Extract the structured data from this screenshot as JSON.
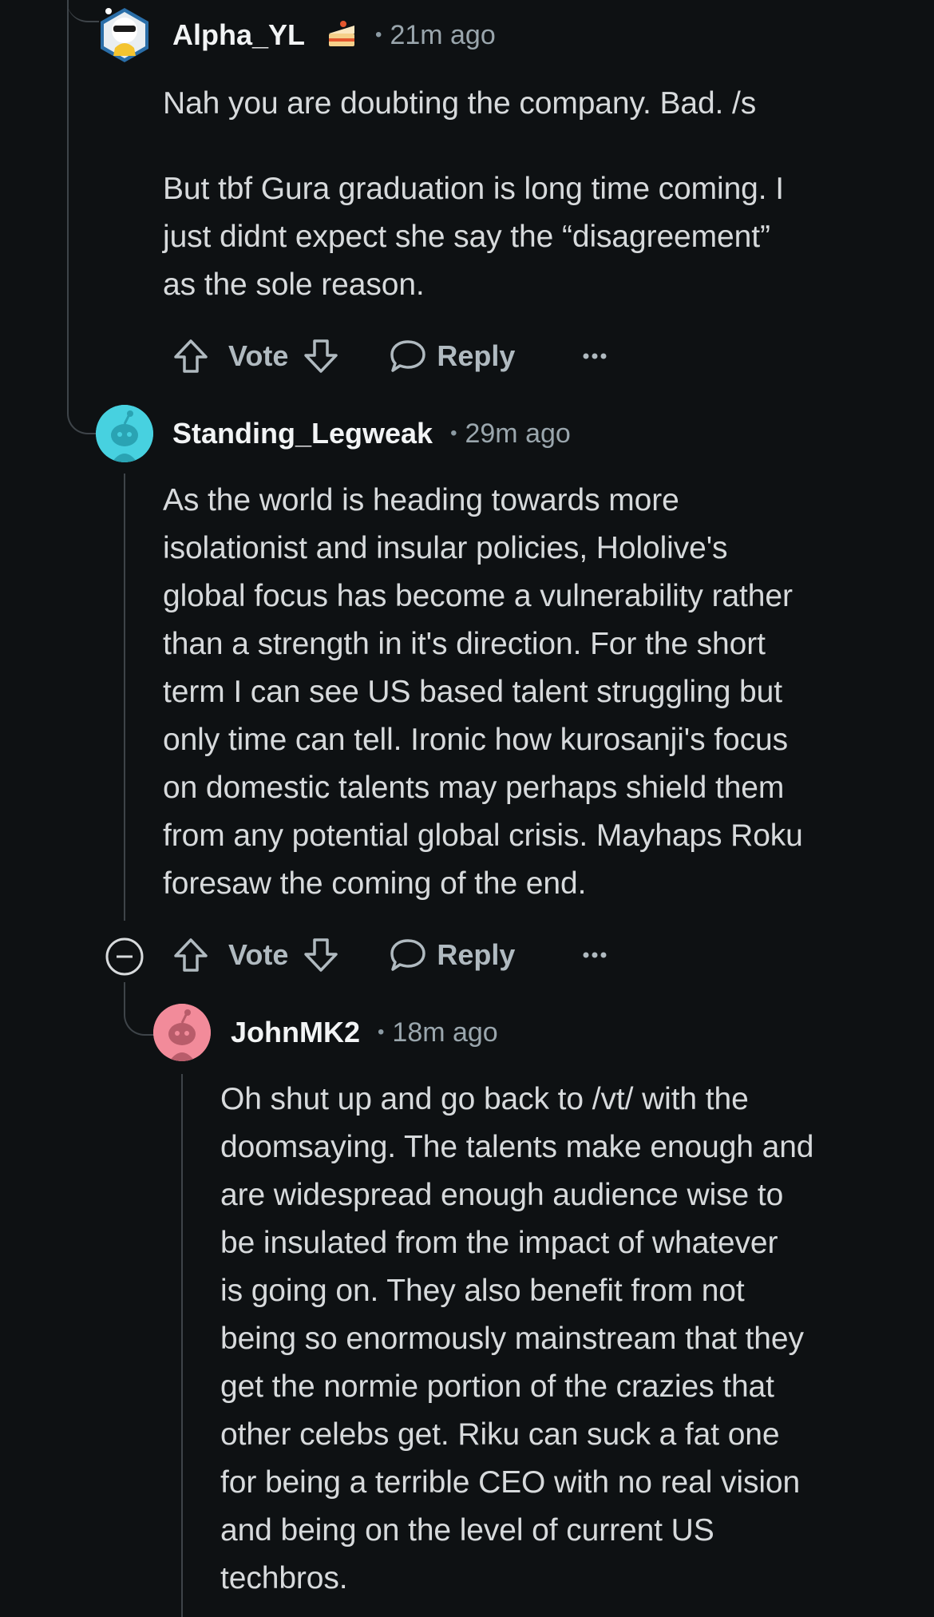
{
  "comments": [
    {
      "username": "Alpha_YL",
      "flair_icon": "cake-icon",
      "time": "21m ago",
      "paragraphs": [
        "Nah you are doubting the company. Bad. /s",
        "But tbf Gura graduation is long time coming. I\njust didnt expect she say the “disagreement”\nas the sole reason."
      ],
      "vote_label": "Vote",
      "reply_label": "Reply",
      "more_icon": "ellipsis-icon",
      "avatar_color": "#ffffff"
    },
    {
      "username": "Standing_Legweak",
      "time": "29m ago",
      "paragraphs": [
        "As the world is heading towards more\nisolationist and insular policies, Hololive's\nglobal focus has become a vulnerability rather\nthan a strength in it's direction. For the short\nterm I can see US based talent struggling but\nonly time can tell. Ironic how kurosanji's focus\non domestic talents may perhaps shield them\nfrom any potential global crisis. Mayhaps Roku\nforesaw the coming of the end."
      ],
      "vote_label": "Vote",
      "reply_label": "Reply",
      "collapse_icon": "collapse-minus-icon",
      "more_icon": "ellipsis-icon",
      "avatar_color": "#47d1e0"
    },
    {
      "username": "JohnMK2",
      "time": "18m ago",
      "paragraphs": [
        "Oh shut up and go back to /vt/ with the\ndoomsaying. The talents make enough and\nare widespread enough audience wise to\nbe insulated from the impact of whatever\nis going on. They also benefit from not\nbeing so enormously mainstream that they\nget the normie portion of the crazies that\nother celebs get. Riku can suck a fat one\nfor being a terrible CEO with no real vision\nand being on the level of current US\ntechbros."
      ],
      "avatar_color": "#f28b9a"
    }
  ]
}
